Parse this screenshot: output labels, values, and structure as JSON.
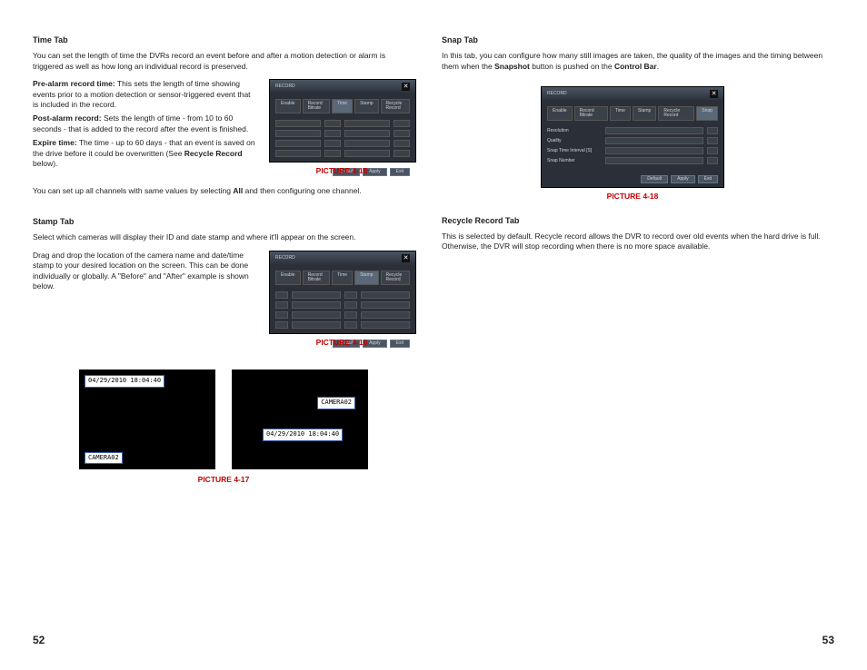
{
  "left": {
    "time_tab": {
      "heading": "Time Tab",
      "intro": "You can set the length of time the DVRs record an event before and after a motion detection or alarm is triggered as well as how long an individual record is preserved.",
      "pre_label": "Pre-alarm record time:",
      "pre_text": " This sets the length of time showing events prior to a motion detection or sensor-triggered event that is included in the record.",
      "post_label": "Post-alarm record:",
      "post_text": " Sets the length of time - from 10 to 60 seconds - that is added to the record after the event is finished.",
      "expire_label": "Expire time:",
      "expire_text_a": " The time - up to 60 days - that an event is saved on the drive before it could be overwritten (See ",
      "expire_text_bold": "Recycle Record",
      "expire_text_b": " below).",
      "all_a": "You can set up all channels with same values by selecting ",
      "all_bold": "All",
      "all_b": " and then configuring one channel."
    },
    "stamp_tab": {
      "heading": "Stamp Tab",
      "intro": "Select which cameras will display their ID and date stamp and where it'll appear on the screen.",
      "para": "Drag and drop the location of the camera name and date/time stamp to your desired location on the screen. This can be done individually or globally. A \"Before\" and \"After\" example is shown below."
    },
    "captions": {
      "p15": "PICTURE 4-15",
      "p16": "PICTURE 4-16",
      "p17": "PICTURE 4-17"
    },
    "black": {
      "timestamp": "04/29/2010 18:04:40",
      "camera": "CAMERA02"
    },
    "page_no": "52"
  },
  "right": {
    "snap_tab": {
      "heading": "Snap Tab",
      "intro_a": "In this tab, you can configure how many still images are taken, the quality of the images and the timing between them when the ",
      "intro_bold1": "Snapshot",
      "intro_b": " button is pushed on the ",
      "intro_bold2": "Control Bar",
      "intro_c": "."
    },
    "recycle_tab": {
      "heading": "Recycle Record Tab",
      "para": "This is selected by default. Recycle record allows the DVR to record over old events when the hard drive is full. Otherwise, the DVR will stop recording when there is no more space available."
    },
    "captions": {
      "p18": "PICTURE 4-18"
    },
    "page_no": "53"
  },
  "dvr": {
    "title": "RECORD",
    "tabs": [
      "Enable",
      "Record Bitrate",
      "Time",
      "Stamp",
      "Recycle Record",
      "Snap"
    ],
    "btn_default": "Default",
    "btn_apply": "Apply",
    "btn_exit": "Exit",
    "snap_rows": [
      "Resolution",
      "Quality",
      "Snap Time Interval [S]",
      "Snap Number"
    ]
  }
}
